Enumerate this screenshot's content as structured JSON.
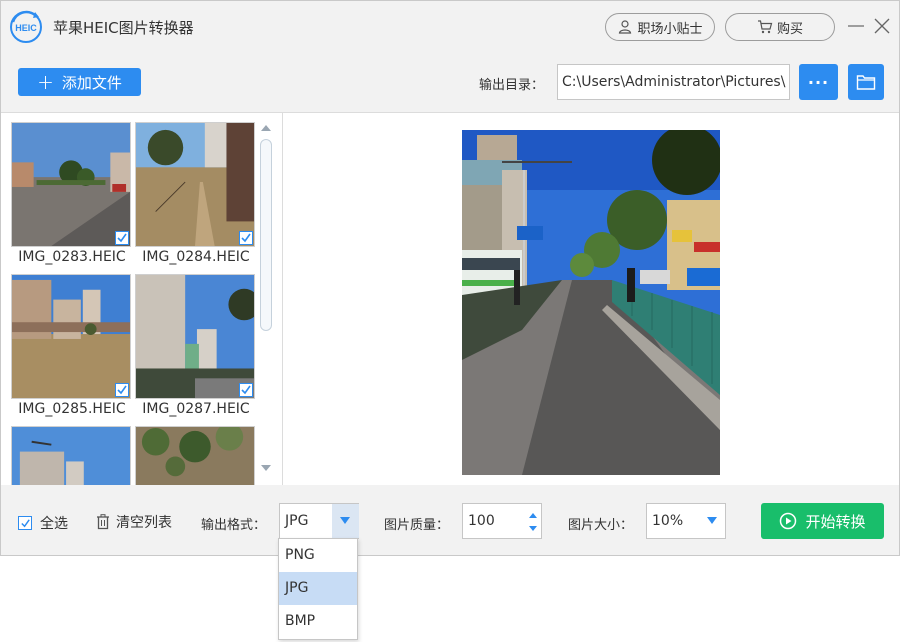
{
  "app": {
    "title": "苹果HEIC图片转换器",
    "logo_text": "HEIC",
    "tips_label": "职场小贴士",
    "buy_label": "购买"
  },
  "toolbar": {
    "add_label": "添加文件",
    "output_label": "输出目录：",
    "output_path": "C:\\Users\\Administrator\\Pictures\\",
    "more_label": "···"
  },
  "files": [
    {
      "name": "IMG_0283.HEIC",
      "checked": true
    },
    {
      "name": "IMG_0284.HEIC",
      "checked": true
    },
    {
      "name": "IMG_0285.HEIC",
      "checked": true
    },
    {
      "name": "IMG_0287.HEIC",
      "checked": true
    }
  ],
  "bottom": {
    "select_all_label": "全选",
    "select_all_checked": true,
    "clear_label": "清空列表",
    "format_label": "输出格式：",
    "format_value": "JPG",
    "quality_label": "图片质量：",
    "quality_value": "100",
    "size_label": "图片大小：",
    "size_value": "10%",
    "start_label": "开始转换"
  },
  "format_options": [
    {
      "label": "PNG",
      "selected": false
    },
    {
      "label": "JPG",
      "selected": true
    },
    {
      "label": "BMP",
      "selected": false
    }
  ],
  "colors": {
    "accent_blue": "#2d8cf0",
    "start_green": "#19be6b",
    "dropdown_selected": "#c7dcf5"
  }
}
